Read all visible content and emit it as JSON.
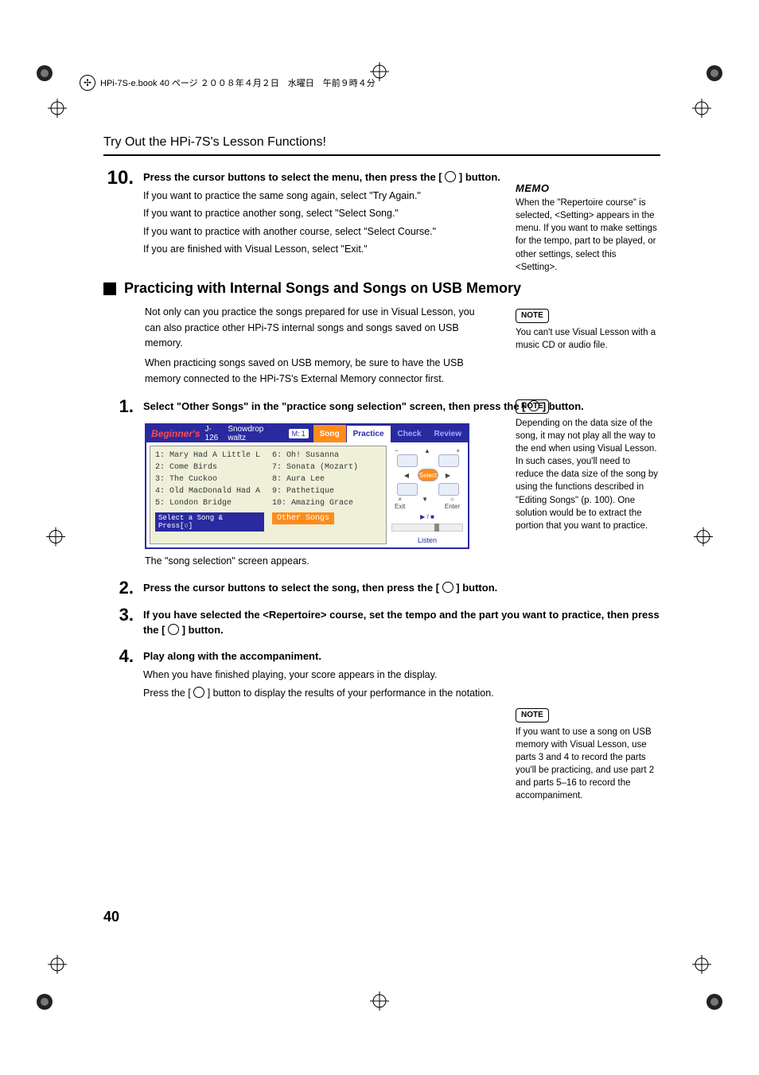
{
  "header": {
    "file_info": "HPi-7S-e.book  40 ページ  ２００８年４月２日　水曜日　午前９時４分"
  },
  "section_title": "Try Out the HPi-7S's Lesson Functions!",
  "page_number": "40",
  "steps": {
    "s10": {
      "num": "10.",
      "title_pre": "Press the cursor buttons to select the menu, then press the [",
      "title_post": "] button.",
      "lines": {
        "l1": "If you want to practice the same song again, select \"Try Again.\"",
        "l2": "If you want to practice another song, select \"Select Song.\"",
        "l3": "If you want to practice with another course, select \"Select Course.\"",
        "l4": "If you are finished with Visual Lesson, select \"Exit.\""
      }
    },
    "h2": "Practicing with Internal Songs and Songs on USB Memory",
    "intro": {
      "p1": "Not only can you practice the songs prepared for use in Visual Lesson, you can also practice other HPi-7S internal songs and songs saved on USB memory.",
      "p2": "When practicing songs saved on USB memory, be sure to have the USB memory connected to the HPi-7S's External Memory connector first."
    },
    "s1": {
      "num": "1.",
      "title_pre": "Select \"Other Songs\" in the \"practice song selection\" screen, then press the [",
      "title_post": "] button."
    },
    "caption1": "The \"song selection\" screen appears.",
    "s2": {
      "num": "2.",
      "title_pre": "Press the cursor buttons to select the song, then press the [",
      "title_post": "] button."
    },
    "s3": {
      "num": "3.",
      "title_pre": "If you have selected the <Repertoire> course, set the tempo and the part you want to practice, then press the [",
      "title_post": "] button."
    },
    "s4": {
      "num": "4.",
      "title": "Play along with the accompaniment.",
      "p1": "When you have finished playing, your score appears in the display.",
      "p2_pre": "Press the [",
      "p2_post": "] button to display the results of your performance in the notation."
    }
  },
  "figure": {
    "level": "Beginner's",
    "song_id": "J-126",
    "song_name": "Snowdrop waltz",
    "measure_label": "M:",
    "measure_val": "1",
    "tabs": {
      "song": "Song",
      "practice": "Practice",
      "check": "Check",
      "review": "Review"
    },
    "left_songs": {
      "i1": "1: Mary Had A Little L",
      "i2": "2: Come Birds",
      "i3": "3: The Cuckoo",
      "i4": "4: Old MacDonald Had A",
      "i5": "5: London Bridge"
    },
    "right_songs": {
      "i6": "6: Oh! Susanna",
      "i7": "7: Sonata (Mozart)",
      "i8": "8: Aura Lee",
      "i9": "9: Pathetique",
      "i10": "10: Amazing Grace"
    },
    "prompt": "Select a Song & Press[○]",
    "other_songs": "Other Songs",
    "nav": {
      "minus": "−",
      "plus": "+",
      "select": "Select",
      "exit": "Exit",
      "enter": "Enter",
      "x": "×",
      "o": "○",
      "listen": "Listen",
      "play": "▶ / ■"
    }
  },
  "side": {
    "memo": {
      "label": "MEMO",
      "text": "When the \"Repertoire course\" is selected, <Setting> appears in the menu. If you want to make settings for the tempo, part to be played, or other settings, select this <Setting>."
    },
    "note1": {
      "label": "NOTE",
      "text": "You can't use Visual Lesson with a music CD or audio file."
    },
    "note2": {
      "label": "NOTE",
      "text": "Depending on the data size of the song, it may not play all the way to the end when using Visual Lesson. In such cases, you'll need to reduce the data size of the song by using the functions described in \"Editing Songs\" (p. 100). One solution would be to extract the portion that you want to practice."
    },
    "note3": {
      "label": "NOTE",
      "text": "If you want to use a song on USB memory with Visual Lesson, use parts 3 and 4 to record the parts you'll be practicing, and use part 2 and parts 5–16 to record the accompaniment."
    }
  }
}
